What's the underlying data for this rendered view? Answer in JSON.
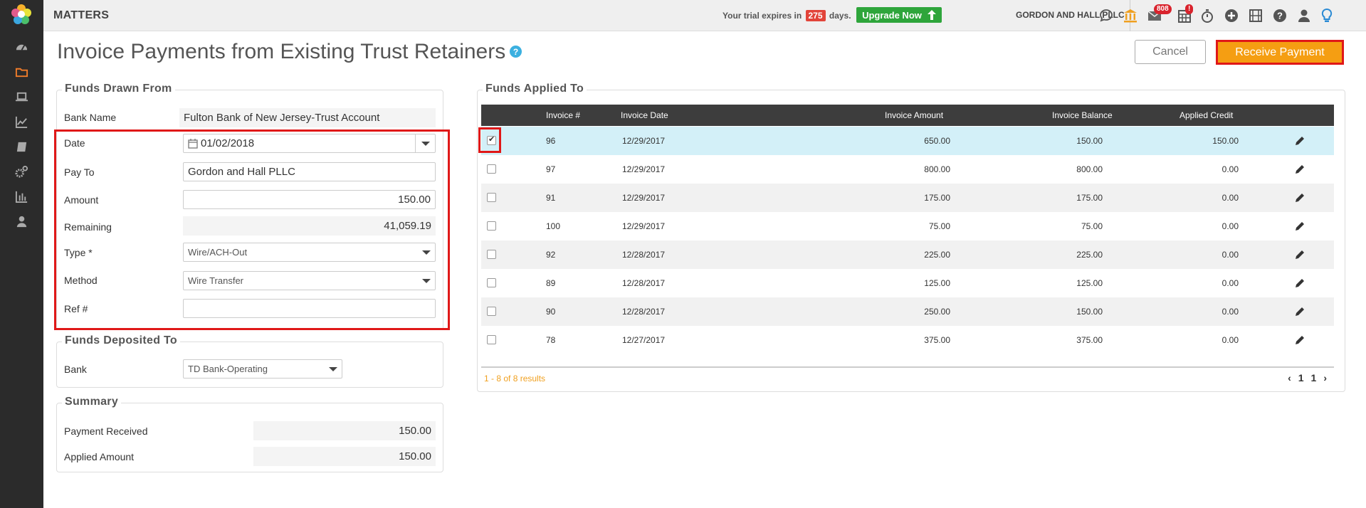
{
  "app": {
    "brand": "MATTERS",
    "trial_prefix": "Your trial expires in",
    "trial_days": "275",
    "trial_suffix": "days.",
    "upgrade_label": "Upgrade Now",
    "firm_name": "GORDON AND HALL PLLC",
    "mail_badge": "808",
    "calendar_badge": "!"
  },
  "sidebar_icons": [
    "dashboard-icon",
    "matters-folder-icon",
    "laptop-icon",
    "trending-chart-icon",
    "book-icon",
    "settings-gears-icon",
    "bar-chart-icon",
    "user-icon"
  ],
  "toolbar_icons": [
    "chat-icon",
    "bank-icon",
    "mail-icon",
    "calendar-icon",
    "stopwatch-icon",
    "add-icon",
    "film-icon",
    "help-icon",
    "account-icon",
    "lightbulb-icon"
  ],
  "page": {
    "title": "Invoice Payments from Existing Trust Retainers",
    "help": "?",
    "cancel_label": "Cancel",
    "receive_label": "Receive Payment"
  },
  "funds_drawn": {
    "title": "Funds Drawn From",
    "bank_name_label": "Bank Name",
    "bank_name": "Fulton Bank of New Jersey-Trust Account",
    "date_label": "Date",
    "date": "01/02/2018",
    "pay_to_label": "Pay To",
    "pay_to": "Gordon and Hall PLLC",
    "amount_label": "Amount",
    "amount": "150.00",
    "remaining_label": "Remaining",
    "remaining": "41,059.19",
    "type_label": "Type *",
    "type": "Wire/ACH-Out",
    "method_label": "Method",
    "method": "Wire Transfer",
    "ref_label": "Ref #",
    "ref": ""
  },
  "funds_deposited": {
    "title": "Funds Deposited To",
    "bank_label": "Bank",
    "bank": "TD Bank-Operating"
  },
  "summary": {
    "title": "Summary",
    "payment_received_label": "Payment Received",
    "payment_received": "150.00",
    "applied_amount_label": "Applied Amount",
    "applied_amount": "150.00"
  },
  "funds_applied": {
    "title": "Funds Applied To",
    "columns": [
      "Invoice #",
      "Invoice Date",
      "Invoice Amount",
      "Invoice Balance",
      "Applied Credit"
    ],
    "rows": [
      {
        "checked": true,
        "invoice": "96",
        "date": "12/29/2017",
        "amount": "650.00",
        "balance": "150.00",
        "applied": "150.00"
      },
      {
        "checked": false,
        "invoice": "97",
        "date": "12/29/2017",
        "amount": "800.00",
        "balance": "800.00",
        "applied": "0.00"
      },
      {
        "checked": false,
        "invoice": "91",
        "date": "12/29/2017",
        "amount": "175.00",
        "balance": "175.00",
        "applied": "0.00"
      },
      {
        "checked": false,
        "invoice": "100",
        "date": "12/29/2017",
        "amount": "75.00",
        "balance": "75.00",
        "applied": "0.00"
      },
      {
        "checked": false,
        "invoice": "92",
        "date": "12/28/2017",
        "amount": "225.00",
        "balance": "225.00",
        "applied": "0.00"
      },
      {
        "checked": false,
        "invoice": "89",
        "date": "12/28/2017",
        "amount": "125.00",
        "balance": "125.00",
        "applied": "0.00"
      },
      {
        "checked": false,
        "invoice": "90",
        "date": "12/28/2017",
        "amount": "250.00",
        "balance": "150.00",
        "applied": "0.00"
      },
      {
        "checked": false,
        "invoice": "78",
        "date": "12/27/2017",
        "amount": "375.00",
        "balance": "375.00",
        "applied": "0.00"
      }
    ],
    "results": "1 - 8 of 8 results",
    "page_current": "1",
    "page_total": "1"
  },
  "colors": {
    "accent_orange": "#f59e12",
    "highlight_red": "#e01818",
    "upgrade_green": "#2ea53b",
    "selected_row": "#d3f0f8",
    "sidebar_bg": "#2b2b2b"
  }
}
